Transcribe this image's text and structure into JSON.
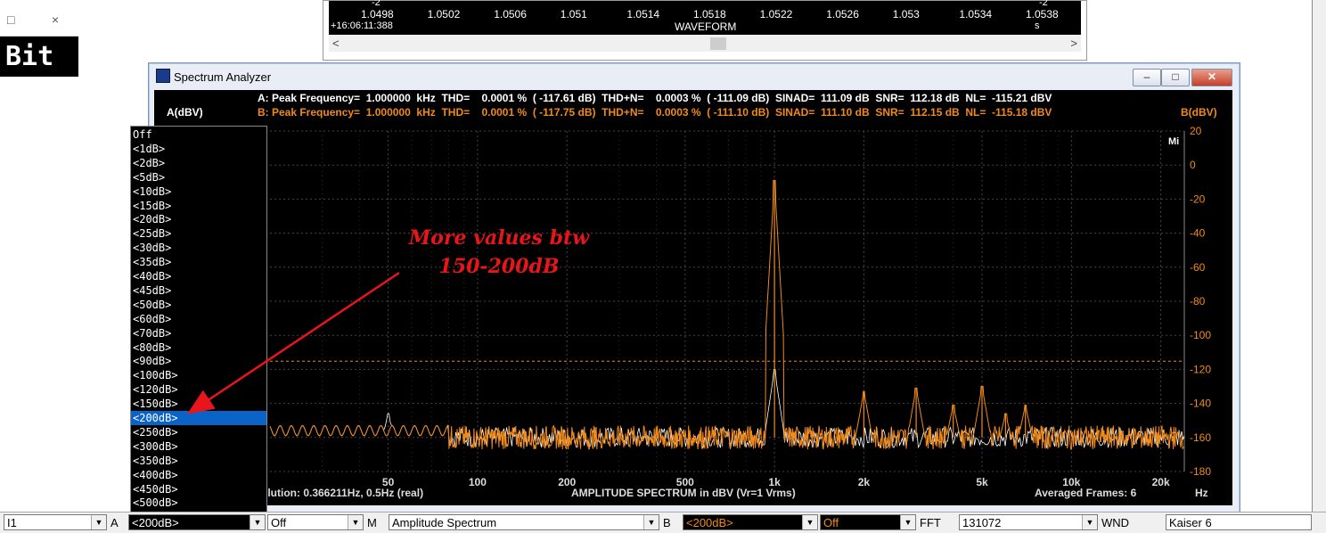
{
  "bit_window": {
    "text": "Bit",
    "min_glyph": "□",
    "close_glyph": "×"
  },
  "waveform": {
    "x_ticks": [
      "1.0498",
      "1.0502",
      "1.0506",
      "1.051",
      "1.0514",
      "1.0518",
      "1.0522",
      "1.0526",
      "1.053",
      "1.0534",
      "1.0538"
    ],
    "minus_left": "-2",
    "minus_right": "-2",
    "time": "+16:06:11:388",
    "label": "WAVEFORM",
    "unit": "s",
    "scroll_left": "<",
    "scroll_right": ">"
  },
  "analyzer": {
    "title": "Spectrum Analyzer",
    "line_a": "A: Peak Frequency=  1.000000  kHz  THD=    0.0001 %  ( -117.61 dB)  THD+N=    0.0003 %  ( -111.09 dB)  SINAD=  111.09 dB  SNR=  112.18 dB  NL=  -115.21 dBV",
    "line_b": "B: Peak Frequency=  1.000000  kHz  THD=    0.0001 %  ( -117.75 dB)  THD+N=    0.0003 %  ( -111.10 dB)  SINAD=  111.10 dB  SNR=  112.15 dB  NL=  -115.18 dBV",
    "left_axis_label": "A(dBV)",
    "right_axis_label": "B(dBV)",
    "corner_label": "Mi",
    "footer_left": "olution: 0.366211Hz, 0.5Hz (real)",
    "footer_center": "AMPLITUDE  SPECTRUM in dBV (Vr=1 Vrms)",
    "footer_right": "Averaged Frames: 6",
    "footer_unit": "Hz"
  },
  "chart_data": {
    "type": "line",
    "title": "AMPLITUDE  SPECTRUM in dBV (Vr=1 Vrms)",
    "xlabel": "Hz",
    "ylabel": "B(dBV)",
    "x_scale": "log",
    "xlim": [
      20,
      24000
    ],
    "ylim": [
      -180,
      20
    ],
    "x_tick_labels": [
      "50",
      "100",
      "200",
      "500",
      "1k",
      "2k",
      "5k",
      "10k",
      "20k"
    ],
    "x_tick_values": [
      50,
      100,
      200,
      500,
      1000,
      2000,
      5000,
      10000,
      20000
    ],
    "y_tick_labels": [
      "20",
      "0",
      "-20",
      "-40",
      "-60",
      "-80",
      "-100",
      "-120",
      "-140",
      "-160",
      "-180"
    ],
    "y_tick_values": [
      20,
      0,
      -20,
      -40,
      -60,
      -80,
      -100,
      -120,
      -140,
      -160,
      -180
    ],
    "grid": true,
    "noise_floor_marker_db": -115.2,
    "series": [
      {
        "name": "A",
        "color": "#ffffff",
        "noise_floor_db": -160,
        "peaks": [
          [
            50,
            -146
          ],
          [
            1000,
            -120
          ]
        ]
      },
      {
        "name": "B",
        "color": "#f08a1a",
        "noise_floor_db": -160,
        "peaks": [
          [
            1000,
            -9
          ],
          [
            2000,
            -133
          ],
          [
            3000,
            -131
          ],
          [
            4000,
            -141
          ],
          [
            5000,
            -130
          ],
          [
            6000,
            -146
          ],
          [
            7000,
            -141
          ]
        ]
      }
    ]
  },
  "dropdown": {
    "items": [
      "Off",
      "<1dB>",
      "<2dB>",
      "<5dB>",
      "<10dB>",
      "<15dB>",
      "<20dB>",
      "<25dB>",
      "<30dB>",
      "<35dB>",
      "<40dB>",
      "<45dB>",
      "<50dB>",
      "<60dB>",
      "<70dB>",
      "<80dB>",
      "<90dB>",
      "<100dB>",
      "<120dB>",
      "<150dB>",
      "<200dB>",
      "<250dB>",
      "<300dB>",
      "<350dB>",
      "<400dB>",
      "<450dB>",
      "<500dB>"
    ],
    "selected": "<200dB>"
  },
  "annotation": {
    "line1": "More values btw",
    "line2": "150-200dB",
    "color": "#e8151a"
  },
  "bottom_bar": {
    "f1": "I1",
    "label_a": "A",
    "a_range": "<200dB>",
    "a_off": "Off",
    "label_m": "M",
    "mode": "Amplitude Spectrum",
    "label_b": "B",
    "b_range": "<200dB>",
    "b_off": "Off",
    "label_fft": "FFT",
    "fft": "131072",
    "label_wnd": "WND",
    "wnd": "Kaiser 6",
    "arrow": "▼"
  },
  "colors": {
    "a_trace": "#ffffff",
    "b_trace": "#f08a1a",
    "selection": "#0a64c8",
    "annotation": "#e8151a"
  }
}
